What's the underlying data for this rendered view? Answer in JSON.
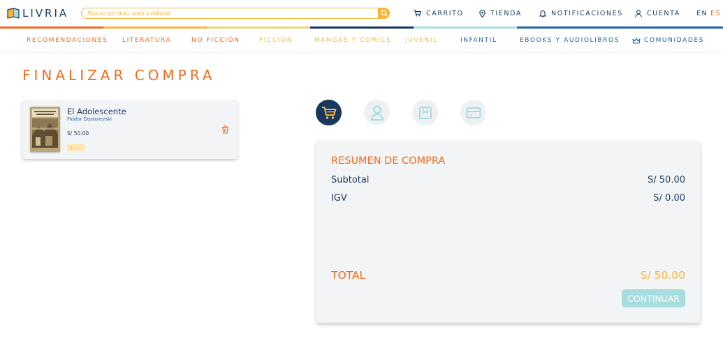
{
  "brand": {
    "name": "LIVRIA",
    "icon": "book-logo-icon"
  },
  "search": {
    "placeholder": "Buscar por título, autor o editorial",
    "icon": "search-icon"
  },
  "topnav": {
    "cart": {
      "label": "CARRITO",
      "icon": "cart-icon"
    },
    "store": {
      "label": "TIENDA",
      "icon": "location-pin-icon"
    },
    "notifications": {
      "label": "NOTIFICACIONES",
      "icon": "bell-icon"
    },
    "account": {
      "label": "CUENTA",
      "icon": "user-icon"
    },
    "lang": {
      "en": "EN",
      "es": "ES",
      "active": "ES"
    }
  },
  "colorbar": [
    "#f26a1b",
    "#f5b73b",
    "#f3d17a",
    "#17375e",
    "#a8dde0",
    "#1f63a8"
  ],
  "categories": [
    {
      "label": "RECOMENDACIONES",
      "color": "#f26a1b"
    },
    {
      "label": "LITERATURA",
      "color": "#f26a1b"
    },
    {
      "label": "NO FICCIÓN",
      "color": "#f26a1b"
    },
    {
      "label": "FICCIÓN",
      "color": "#f5b73b"
    },
    {
      "label": "MANGAS Y COMICS",
      "color": "#f5b73b"
    },
    {
      "label": "JUVENIL",
      "color": "#f5b73b"
    },
    {
      "label": "INFANTIL",
      "color": "#1f63a8"
    },
    {
      "label": "EBOOKS Y AUDIOLIBROS",
      "color": "#1f63a8"
    },
    {
      "label": "COMUNIDADES",
      "color": "#1f63a8",
      "icon": "crown-icon"
    }
  ],
  "page": {
    "title": "FINALIZAR COMPRA"
  },
  "cart_item": {
    "title": "El Adolescente",
    "author": "Fiódor Dostoievski",
    "price": "S/ 50.00",
    "quantity": "1",
    "quantity_arrow": "⌄",
    "remove_icon": "trash-icon"
  },
  "steps": [
    {
      "icon": "cart-icon",
      "active": true
    },
    {
      "icon": "user-icon",
      "active": false
    },
    {
      "icon": "bookmark-icon",
      "active": false
    },
    {
      "icon": "credit-card-icon",
      "active": false
    }
  ],
  "summary": {
    "title": "RESUMEN DE COMPRA",
    "subtotal_label": "Subtotal",
    "subtotal_value": "S/ 50.00",
    "igv_label": "IGV",
    "igv_value": "S/ 0.00",
    "total_label": "TOTAL",
    "total_value": "S/ 50.00",
    "continue_label": "CONTINUAR"
  }
}
